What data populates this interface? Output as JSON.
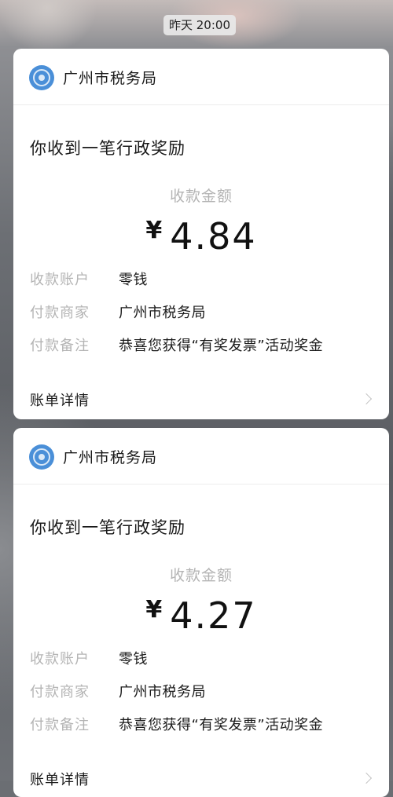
{
  "timestamp": "昨天 20:00",
  "messages": [
    {
      "sender": "广州市税务局",
      "logo_icon": "tax-bureau-logo-icon",
      "headline": "你收到一笔行政奖励",
      "amount_label": "收款金额",
      "currency": "¥",
      "amount": "4.84",
      "rows": [
        {
          "label": "收款账户",
          "value": "零钱"
        },
        {
          "label": "付款商家",
          "value": "广州市税务局"
        },
        {
          "label": "付款备注",
          "value": "恭喜您获得“有奖发票”活动奖金"
        }
      ],
      "details_label": "账单详情"
    },
    {
      "sender": "广州市税务局",
      "logo_icon": "tax-bureau-logo-icon",
      "headline": "你收到一笔行政奖励",
      "amount_label": "收款金额",
      "currency": "¥",
      "amount": "4.27",
      "rows": [
        {
          "label": "收款账户",
          "value": "零钱"
        },
        {
          "label": "付款商家",
          "value": "广州市税务局"
        },
        {
          "label": "付款备注",
          "value": "恭喜您获得“有奖发票”活动奖金"
        }
      ],
      "details_label": "账单详情"
    }
  ]
}
